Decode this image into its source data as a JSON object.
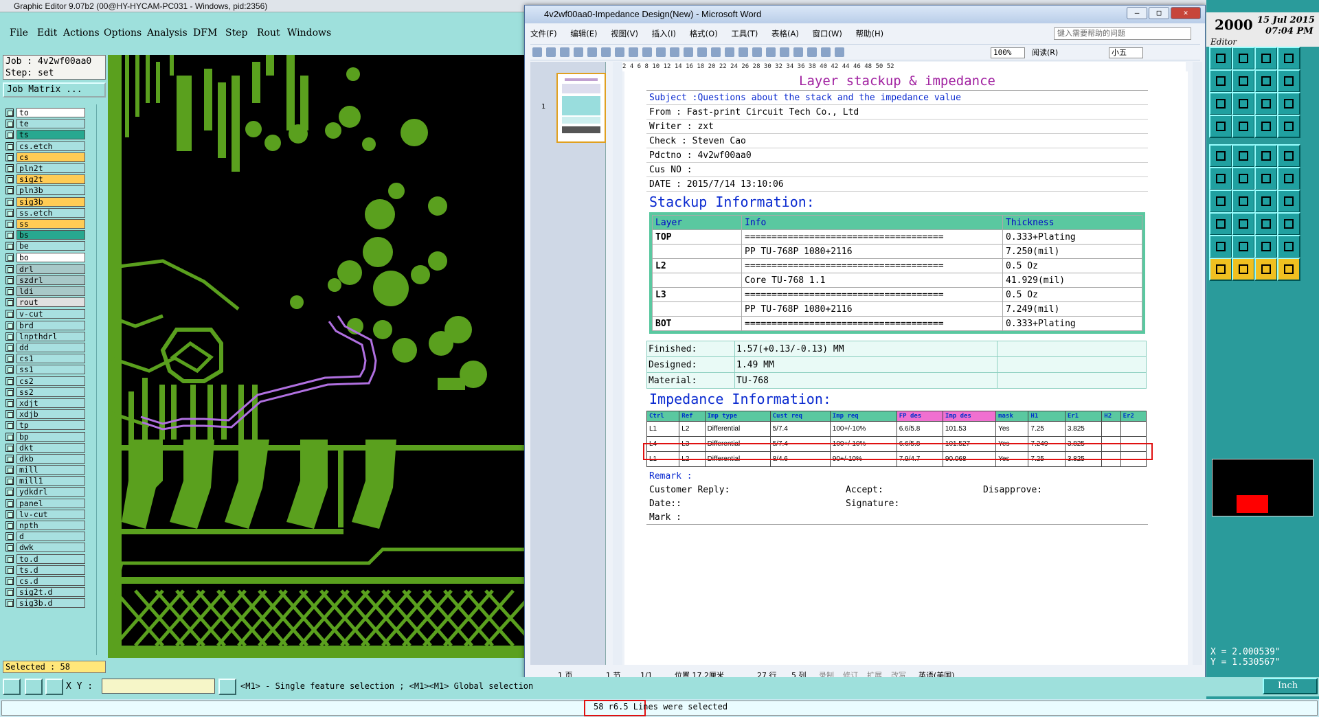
{
  "ge": {
    "title": "Graphic Editor 9.07b2 (00@HY-HYCAM-PC031 - Windows, pid:2356)",
    "menu": [
      "File",
      "Edit",
      "Actions",
      "Options",
      "Analysis",
      "DFM",
      "Step",
      "Rout",
      "Windows"
    ],
    "job": "Job : 4v2wf00aa0",
    "step": "Step: set",
    "job_matrix": "Job Matrix ...",
    "selected": "Selected : 58",
    "xy_label": "X Y :",
    "hint": "<M1> - Single feature selection ; <M1><M1> Global selection",
    "status": "58 r6.5 Lines were selected",
    "units": "Inch",
    "layers": [
      {
        "name": "to",
        "color": "#ffffff"
      },
      {
        "name": "te",
        "color": "#a8e0e0"
      },
      {
        "name": "ts",
        "color": "#28a890"
      },
      {
        "name": "cs.etch",
        "color": "#a8e0e0"
      },
      {
        "name": "cs",
        "color": "#ffcc55",
        "active": true
      },
      {
        "name": "pln2t",
        "color": "#a8e0e0"
      },
      {
        "name": "sig2t",
        "color": "#ffcc55"
      },
      {
        "name": "pln3b",
        "color": "#a8e0e0"
      },
      {
        "name": "sig3b",
        "color": "#ffcc55"
      },
      {
        "name": "ss.etch",
        "color": "#a8e0e0"
      },
      {
        "name": "ss",
        "color": "#ffcc55"
      },
      {
        "name": "bs",
        "color": "#28a890"
      },
      {
        "name": "be",
        "color": "#a8e0e0"
      },
      {
        "name": "bo",
        "color": "#ffffff"
      },
      {
        "name": "drl",
        "color": "#a8c8c8"
      },
      {
        "name": "szdrl",
        "color": "#a8c8c8"
      },
      {
        "name": "ldi",
        "color": "#a8c8c8"
      },
      {
        "name": "rout",
        "color": "#e0e0e0"
      },
      {
        "name": "v-cut",
        "color": "#a8e0e0"
      },
      {
        "name": "brd",
        "color": "#a8e0e0"
      },
      {
        "name": "lnpthdrl",
        "color": "#a8e0e0"
      },
      {
        "name": "dd",
        "color": "#a8e0e0"
      },
      {
        "name": "cs1",
        "color": "#a8e0e0"
      },
      {
        "name": "ss1",
        "color": "#a8e0e0"
      },
      {
        "name": "cs2",
        "color": "#a8e0e0"
      },
      {
        "name": "ss2",
        "color": "#a8e0e0"
      },
      {
        "name": "xdjt",
        "color": "#a8e0e0"
      },
      {
        "name": "xdjb",
        "color": "#a8e0e0"
      },
      {
        "name": "tp",
        "color": "#a8e0e0"
      },
      {
        "name": "bp",
        "color": "#a8e0e0"
      },
      {
        "name": "dkt",
        "color": "#a8e0e0"
      },
      {
        "name": "dkb",
        "color": "#a8e0e0"
      },
      {
        "name": "mill",
        "color": "#a8e0e0"
      },
      {
        "name": "mill1",
        "color": "#a8e0e0"
      },
      {
        "name": "ydkdrl",
        "color": "#a8e0e0"
      },
      {
        "name": "panel",
        "color": "#a8e0e0"
      },
      {
        "name": "lv-cut",
        "color": "#a8e0e0"
      },
      {
        "name": "npth",
        "color": "#a8e0e0"
      },
      {
        "name": "d",
        "color": "#a8e0e0"
      },
      {
        "name": "dwk",
        "color": "#a8e0e0"
      },
      {
        "name": "to.d",
        "color": "#a8e0e0"
      },
      {
        "name": "ts.d",
        "color": "#a8e0e0"
      },
      {
        "name": "cs.d",
        "color": "#a8e0e0"
      },
      {
        "name": "sig2t.d",
        "color": "#a8e0e0"
      },
      {
        "name": "sig3b.d",
        "color": "#a8e0e0"
      }
    ],
    "date": {
      "year": "2000",
      "day": "15 Jul 2015",
      "time": "07:04 PM",
      "app": "Editor"
    },
    "coords": {
      "x": "X = 2.000539\"",
      "y": "Y = 1.530567\""
    },
    "colors": {
      "board_bg": "#000000",
      "copper": "#5aa01e",
      "selected": "#b070e0",
      "panel_bg": "#9ee0dc",
      "right_bg": "#2a9b9b"
    }
  },
  "word": {
    "title": "4v2wf00aa0-Impedance Design(New) - Microsoft Word",
    "menu": [
      "文件(F)",
      "编辑(E)",
      "视图(V)",
      "插入(I)",
      "格式(O)",
      "工具(T)",
      "表格(A)",
      "窗口(W)",
      "帮助(H)"
    ],
    "help_placeholder": "键入需要帮助的问题",
    "zoom": "100%",
    "read": "阅读(R)",
    "font_size": "小五",
    "thumb_page": "1",
    "ruler": "2  4  6  8  10  12  14  16  18  20  22  24  26  28  30  32  34  36  38  40  42  44  46  48  50  52",
    "status": {
      "page": "1 页",
      "section": "1 节",
      "pages": "1/1",
      "pos": "位置 17.2厘米",
      "line": "27 行",
      "col": "5 列",
      "rec": "录制",
      "trk": "修订",
      "ext": "扩展",
      "ovr": "改写",
      "lang": "英语(美国)"
    },
    "doc": {
      "title": "Layer stackup & impedance",
      "subject": "Subject :Questions about the stack and the impedance value",
      "from": "From   : Fast-print Circuit Tech Co., Ltd",
      "writer": "Writer  : zxt",
      "check": "Check   : Steven Cao",
      "pdctno": "Pdctno  : 4v2wf00aa0",
      "cusno": "Cus NO  :",
      "date": "DATE    : 2015/7/14 13:10:06",
      "stack_heading": "Stackup Information:",
      "stack_headers": [
        "Layer",
        "Info",
        "Thickness"
      ],
      "stack_rows": [
        [
          "TOP",
          "=====================================",
          "0.333+Plating"
        ],
        [
          "",
          "PP     TU-768P    1080+2116",
          "7.250(mil)"
        ],
        [
          "L2",
          "=====================================",
          "0.5 Oz"
        ],
        [
          "",
          "Core     TU-768    1.1",
          "41.929(mil)"
        ],
        [
          "L3",
          "=====================================",
          "0.5 Oz"
        ],
        [
          "",
          "PP     TU-768P    1080+2116",
          "7.249(mil)"
        ],
        [
          "BOT",
          "=====================================",
          "0.333+Plating"
        ]
      ],
      "finished_label": "Finished:",
      "finished": "1.57(+0.13/-0.13) MM",
      "designed_label": "Designed:",
      "designed": "1.49 MM",
      "material_label": "Material:",
      "material": "TU-768",
      "imp_heading": "Impedance Information:",
      "imp_headers": [
        "Ctrl",
        "Ref",
        "Imp type",
        "Cust req",
        "Imp req",
        "FP des",
        "Imp des",
        "mask",
        "H1",
        "Er1",
        "H2",
        "Er2"
      ],
      "imp_rows": [
        [
          "L1",
          "L2",
          "Differential",
          "5/7.4",
          "100+/-10%",
          "6.6/5.8",
          "101.53",
          "Yes",
          "7.25",
          "3.825",
          "",
          ""
        ],
        [
          "L4",
          "L3",
          "Differential",
          "5/7.4",
          "100+/-10%",
          "6.6/5.8",
          "101.527",
          "Yes",
          "7.249",
          "3.825",
          "",
          ""
        ],
        [
          "L1",
          "L2",
          "Differential",
          "8/4.6",
          "90+/-10%",
          "7.9/4.7",
          "90.068",
          "Yes",
          "7.25",
          "3.825",
          "",
          ""
        ]
      ],
      "remark": "Remark :",
      "customer_reply": "Customer Reply:",
      "accept": "Accept:",
      "disapprove": "Disapprove:",
      "date2": "Date::",
      "signature": "Signature:",
      "mark": "Mark :"
    }
  }
}
